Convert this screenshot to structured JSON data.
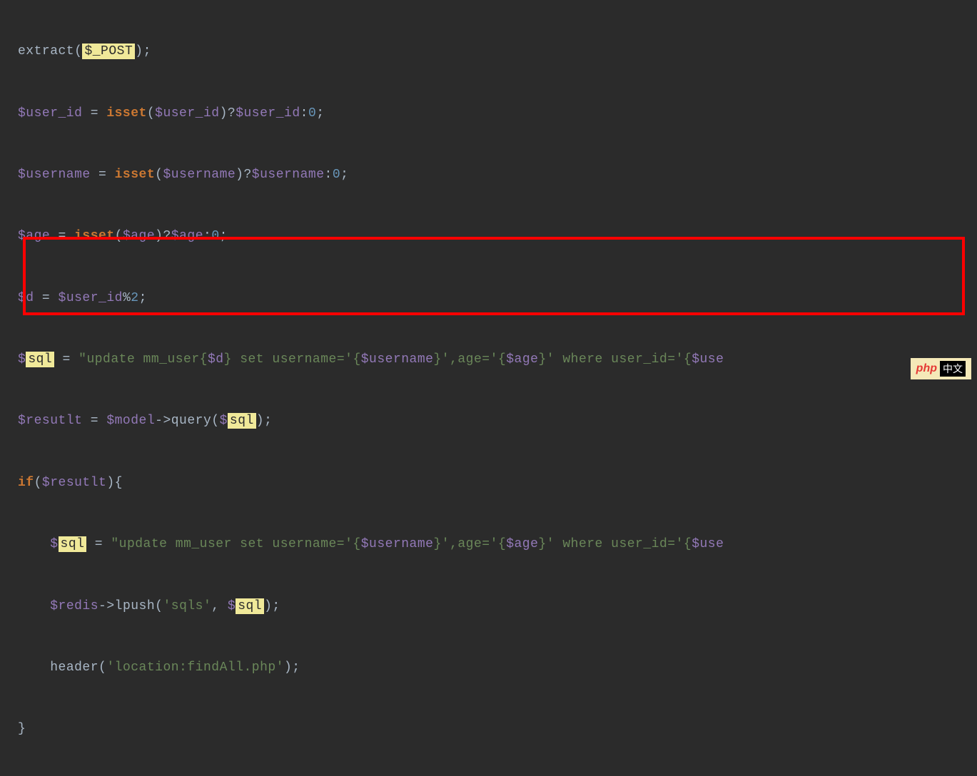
{
  "code": {
    "line1": {
      "fn": "extract",
      "open": "(",
      "var": "$_POST",
      "close": ")",
      "semi": ";"
    },
    "line2": {
      "var1": "$user_id",
      "eq": " = ",
      "kw": "isset",
      "open": "(",
      "var2": "$user_id",
      "close": ")",
      "tern": "?",
      "var3": "$user_id",
      "colon": ":",
      "num": "0",
      "semi": ";"
    },
    "line3": {
      "var1": "$username",
      "eq": " = ",
      "kw": "isset",
      "open": "(",
      "var2": "$username",
      "close": ")",
      "tern": "?",
      "var3": "$username",
      "colon": ":",
      "num": "0",
      "semi": ";"
    },
    "line4": {
      "var1": "$age",
      "eq": " = ",
      "kw": "isset",
      "open": "(",
      "var2": "$age",
      "close": ")",
      "tern": "?",
      "var3": "$age",
      "colon": ":",
      "num": "0",
      "semi": ";"
    },
    "line5": {
      "var1": "$d",
      "eq": " = ",
      "var2": "$user_id",
      "mod": "%",
      "num": "2",
      "semi": ";"
    },
    "line6": {
      "dollar": "$",
      "sql": "sql",
      "eq": " = ",
      "q1": "\"",
      "t1": "update mm_user",
      "ob1": "{",
      "v1": "$d",
      "cb1": "}",
      "t2": " set username='",
      "ob2": "{",
      "v2": "$username",
      "cb2": "}",
      "t3": "',age='",
      "ob3": "{",
      "v3": "$age",
      "cb3": "}",
      "t4": "' where user_id='",
      "ob4": "{",
      "v4": "$use"
    },
    "line7": {
      "var1": "$resutlt",
      "eq": " = ",
      "var2": "$model",
      "arrow": "->",
      "fn": "query",
      "open": "(",
      "dollar": "$",
      "sql": "sql",
      "close": ")",
      "semi": ";"
    },
    "line8": {
      "kw": "if",
      "open": "(",
      "var": "$resutlt",
      "close": ")",
      "brace": "{"
    },
    "line9": {
      "indent": "    ",
      "dollar": "$",
      "sql": "sql",
      "eq": " = ",
      "q1": "\"",
      "t1": "update mm_user set username='",
      "ob1": "{",
      "v1": "$username",
      "cb1": "}",
      "t2": "',age='",
      "ob2": "{",
      "v2": "$age",
      "cb2": "}",
      "t3": "' where user_id='",
      "ob3": "{",
      "v3": "$use"
    },
    "line10": {
      "indent": "    ",
      "var1": "$redis",
      "arrow": "->",
      "fn": "lpush",
      "open": "(",
      "str": "'sqls'",
      "comma": ", ",
      "dollar": "$",
      "sql": "sql",
      "close": ")",
      "semi": ";"
    },
    "line11": {
      "indent": "    ",
      "fn": "header",
      "open": "(",
      "str": "'location:findAll.php'",
      "close": ")",
      "semi": ";"
    },
    "line12": {
      "brace": "}"
    }
  },
  "watermark": {
    "php": "php",
    "cn": "中文"
  }
}
